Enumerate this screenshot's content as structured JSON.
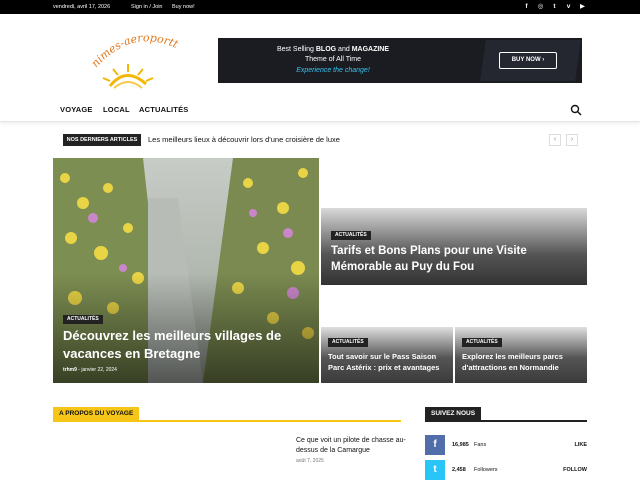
{
  "topbar": {
    "date": "vendredi, avril 17, 2026",
    "signin": "Sign in / Join",
    "buynow": "Buy now!",
    "socials": [
      {
        "icon": "facebook-icon",
        "glyph": "f"
      },
      {
        "icon": "instagram-icon",
        "glyph": "◎"
      },
      {
        "icon": "twitter-icon",
        "glyph": "t"
      },
      {
        "icon": "vimeo-icon",
        "glyph": "v"
      },
      {
        "icon": "youtube-icon",
        "glyph": "▶"
      }
    ]
  },
  "logo": {
    "text": "nimes-aeroporttm"
  },
  "ad": {
    "line1_pre": "Best Selling ",
    "line1_bold1": "BLOG",
    "line1_mid": " and ",
    "line1_bold2": "MAGAZINE",
    "line2": "Theme of All Time",
    "line3": "Experience the change!",
    "button": "BUY NOW  ›"
  },
  "nav": {
    "items": [
      "VOYAGE",
      "LOCAL",
      "ACTUALITÉS"
    ]
  },
  "ticker": {
    "label": "NOS DERNIERS ARTICLES",
    "text": "Les meilleurs lieux à découvrir lors d'une croisière de luxe",
    "prev": "‹",
    "next": "›"
  },
  "hero": {
    "main": {
      "tag": "ACTUALITÉS",
      "title": "Découvrez les meilleurs villages de vacances en Bretagne",
      "author": "trhm9",
      "sep": " - ",
      "date": "janvier 22, 2024"
    },
    "top_right": {
      "tag": "ACTUALITÉS",
      "title": "Tarifs et Bons Plans pour une Visite Mémorable au Puy du Fou"
    },
    "bottom_left": {
      "tag": "ACTUALITÉS",
      "title": "Tout savoir sur le Pass Saison Parc Astérix : prix et avantages"
    },
    "bottom_right": {
      "tag": "ACTUALITÉS",
      "title": "Explorez les meilleurs parcs d'attractions en Normandie"
    }
  },
  "about": {
    "title": "A PROPOS DU VOYAGE",
    "article": {
      "title": "Ce que voit un pilote de chasse au-dessus de la Camargue",
      "date": "août 7, 2025"
    }
  },
  "follow": {
    "title": "SUIVEZ NOUS",
    "rows": [
      {
        "icon": "facebook-icon",
        "glyph": "f",
        "color": "#516eab",
        "count": "16,985",
        "label": "Fans",
        "action": "LIKE"
      },
      {
        "icon": "twitter-icon",
        "glyph": "t",
        "color": "#29c5f6",
        "count": "2,458",
        "label": "Followers",
        "action": "FOLLOW"
      }
    ]
  },
  "colors": {
    "accent_yellow": "#f5c518",
    "dark": "#222222",
    "ad_blue": "#36c4ef"
  }
}
